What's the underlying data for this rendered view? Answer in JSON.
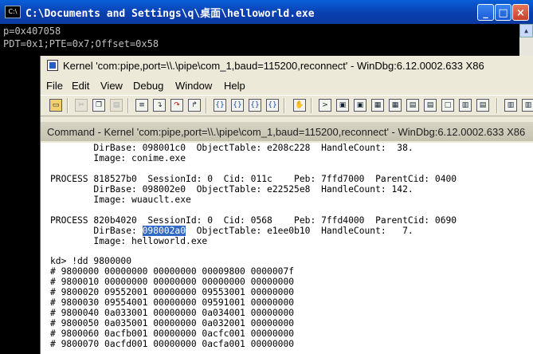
{
  "console": {
    "title": "C:\\Documents and Settings\\q\\桌面\\helloworld.exe",
    "icon_label": "C:\\",
    "lines": [
      "p=0x407058",
      "PDT=0x1;PTE=0x7;Offset=0x58"
    ],
    "controls": {
      "minimize": "_",
      "maximize": "□",
      "close": "×"
    }
  },
  "windbg": {
    "title": "Kernel 'com:pipe,port=\\\\.\\pipe\\com_1,baud=115200,reconnect' - WinDbg:6.12.0002.633 X86",
    "menu": [
      "File",
      "Edit",
      "View",
      "Debug",
      "Window",
      "Help"
    ],
    "toolbar_icons": [
      "open-icon",
      "cut-icon",
      "copy-icon",
      "paste-icon",
      "source-mode-icon",
      "step-into-icon",
      "step-over-icon",
      "step-out-icon",
      "run-to-cursor-icon",
      "break-icon",
      "go-icon",
      "restart-icon",
      "hand-icon",
      "command-window-icon",
      "watch-window-icon",
      "locals-window-icon",
      "registers-window-icon",
      "memory-window-icon",
      "call-stack-icon",
      "disassembly-icon",
      "scratch-pad-icon",
      "options-icon"
    ],
    "command_window": {
      "title": "Command - Kernel 'com:pipe,port=\\\\.\\pipe\\com_1,baud=115200,reconnect' - WinDbg:6.12.0002.633 X86",
      "pre": "        DirBase: 098001c0  ObjectTable: e208c228  HandleCount:  38.\n        Image: conime.exe\n\nPROCESS 818527b0  SessionId: 0  Cid: 011c    Peb: 7ffd7000  ParentCid: 0400\n        DirBase: 098002e0  ObjectTable: e22525e8  HandleCount: 142.\n        Image: wuauclt.exe\n\nPROCESS 820b4020  SessionId: 0  Cid: 0568    Peb: 7ffd4000  ParentCid: 0690\n        DirBase: ",
      "selected": "098002a0",
      "post": "  ObjectTable: e1ee0b10  HandleCount:   7.\n        Image: helloworld.exe\n\nkd> !dd 9800000\n# 9800000 00000000 00000000 00009800 0000007f\n# 9800010 00000000 00000000 00000000 00000000\n# 9800020 09552001 00000000 09553001 00000000\n# 9800030 09554001 00000000 09591001 00000000\n# 9800040 0a033001 00000000 0a034001 00000000\n# 9800050 0a035001 00000000 0a032001 00000000\n# 9800060 0acfb001 00000000 0acfc001 00000000\n# 9800070 0acfd001 00000000 0acfa001 00000000"
    }
  }
}
